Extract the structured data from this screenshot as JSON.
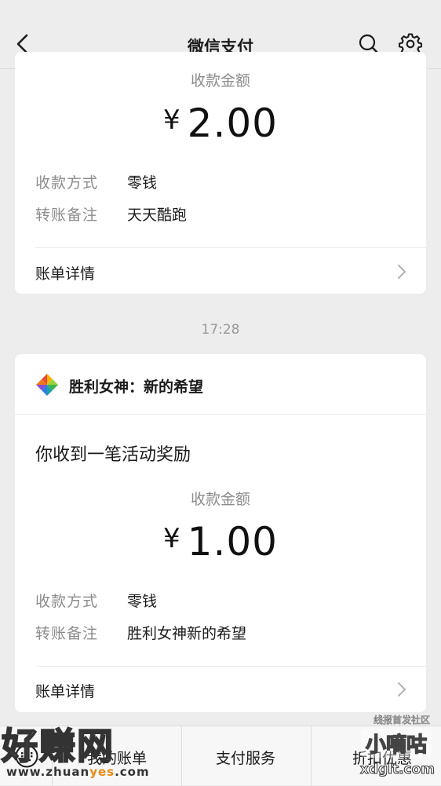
{
  "header": {
    "title": "微信支付",
    "back_icon": "chevron-left-icon",
    "search_icon": "search-icon",
    "settings_icon": "gear-icon"
  },
  "messages": [
    {
      "amount_label": "收款金额",
      "currency": "¥",
      "amount": "2.00",
      "fields": [
        {
          "key": "收款方式",
          "value": "零钱"
        },
        {
          "key": "转账备注",
          "value": "天天酷跑"
        }
      ],
      "detail_label": "账单详情"
    },
    {
      "merchant": "胜利女神：新的希望",
      "notice": "你收到一笔活动奖励",
      "amount_label": "收款金额",
      "currency": "¥",
      "amount": "1.00",
      "fields": [
        {
          "key": "收款方式",
          "value": "零钱"
        },
        {
          "key": "转账备注",
          "value": "胜利女神新的希望"
        }
      ],
      "detail_label": "账单详情"
    }
  ],
  "timestamp": "17:28",
  "bottom_bar": {
    "keyboard_icon": "keyboard-icon",
    "tabs": [
      "我的账单",
      "支付服务",
      "折扣优惠"
    ]
  },
  "watermarks": {
    "left_big": "好赚网",
    "left_small_a": "www.zhuan",
    "left_small_b": "yes",
    "left_small_c": ".com",
    "right_top": "线报首发社区",
    "right_mid": "小嘀咕",
    "right_bot": "xdglt.com"
  },
  "colors": {
    "background": "#ededed",
    "card": "#ffffff",
    "muted_text": "#8c8c8c"
  }
}
